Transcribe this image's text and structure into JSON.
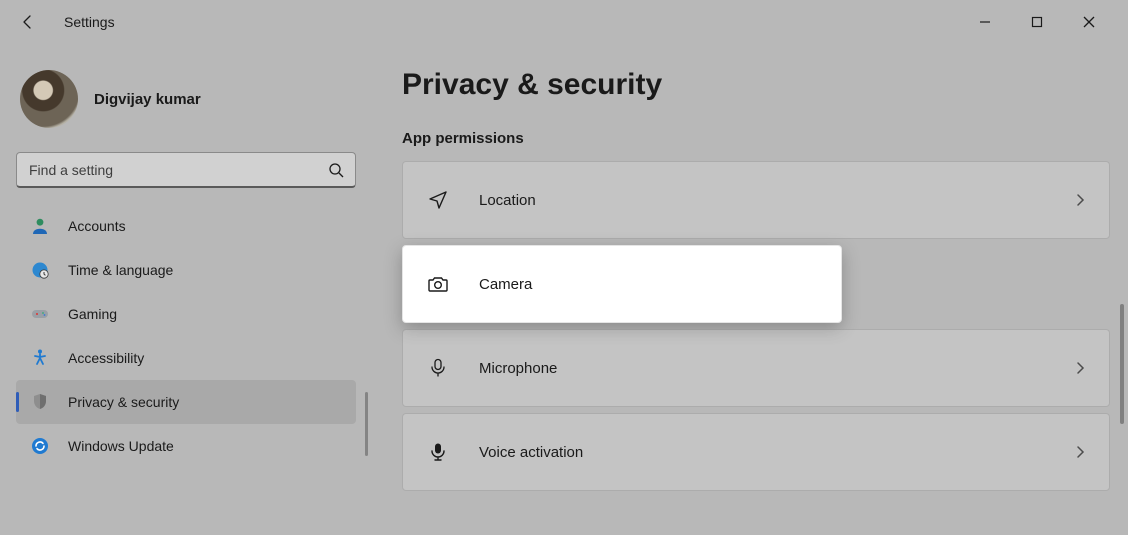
{
  "window": {
    "title": "Settings"
  },
  "profile": {
    "name": "Digvijay kumar"
  },
  "search": {
    "placeholder": "Find a setting"
  },
  "sidebar": {
    "items": [
      {
        "label": "Accounts",
        "icon": "accounts",
        "active": false
      },
      {
        "label": "Time & language",
        "icon": "time-language",
        "active": false
      },
      {
        "label": "Gaming",
        "icon": "gaming",
        "active": false
      },
      {
        "label": "Accessibility",
        "icon": "accessibility",
        "active": false
      },
      {
        "label": "Privacy & security",
        "icon": "privacy-security",
        "active": true
      },
      {
        "label": "Windows Update",
        "icon": "windows-update",
        "active": false
      }
    ]
  },
  "page": {
    "title": "Privacy & security",
    "section": "App permissions",
    "items": [
      {
        "label": "Location",
        "icon": "location",
        "highlight": false
      },
      {
        "label": "Camera",
        "icon": "camera",
        "highlight": true
      },
      {
        "label": "Microphone",
        "icon": "microphone",
        "highlight": false
      },
      {
        "label": "Voice activation",
        "icon": "voice-activation",
        "highlight": false
      }
    ]
  }
}
